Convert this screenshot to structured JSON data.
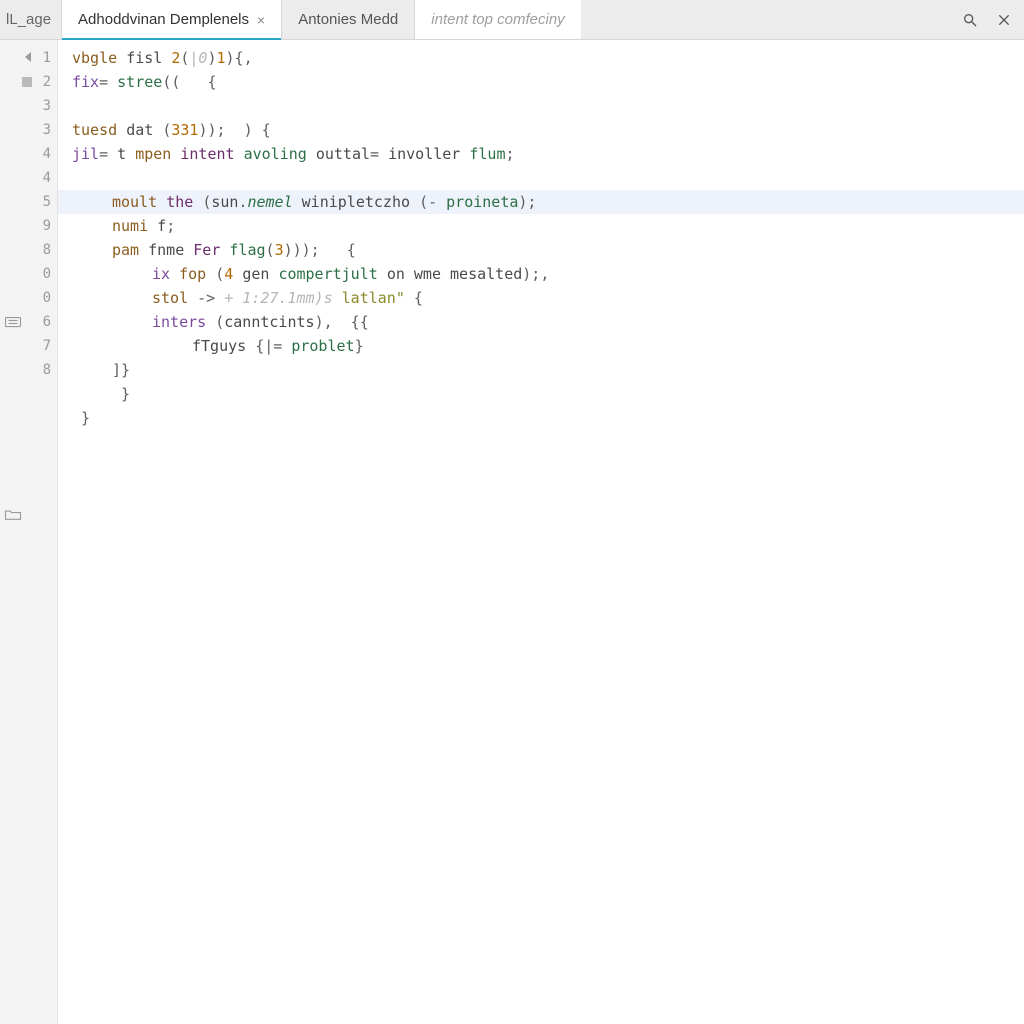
{
  "tabs": {
    "stub_label": "lL_age",
    "items": [
      {
        "label": "Adhoddvinan Demplenels",
        "active": true,
        "closeable": true
      },
      {
        "label": "Antonies Medd",
        "active": false,
        "closeable": false
      }
    ],
    "breadcrumb_hint": "intent top comfeciny"
  },
  "gutter": {
    "lines": [
      {
        "num": "1",
        "fold": true
      },
      {
        "num": "2",
        "bp": true
      },
      {
        "num": "3"
      },
      {
        "num": "3"
      },
      {
        "num": "4"
      },
      {
        "num": "4"
      },
      {
        "num": "5"
      },
      {
        "num": "9"
      },
      {
        "num": "8"
      },
      {
        "num": "0"
      },
      {
        "num": "0"
      },
      {
        "num": "6",
        "marker": "collapse"
      },
      {
        "num": "7"
      },
      {
        "num": "8"
      },
      {
        "num": ""
      },
      {
        "num": ""
      }
    ],
    "folder_marker_line_index": 19
  },
  "code": {
    "lines": [
      {
        "indent": 0,
        "tokens": [
          {
            "t": "vbgle ",
            "c": "tk-kw2"
          },
          {
            "t": "fisl ",
            "c": "tk-id"
          },
          {
            "t": "2",
            "c": "tk-num"
          },
          {
            "t": "(",
            "c": "tk-punc"
          },
          {
            "t": "|0",
            "c": "tk-cmt"
          },
          {
            "t": ")",
            "c": "tk-punc"
          },
          {
            "t": "1",
            "c": "tk-num"
          },
          {
            "t": "){,",
            "c": "tk-punc"
          }
        ]
      },
      {
        "indent": 0,
        "tokens": [
          {
            "t": "fix",
            "c": "tk-kw"
          },
          {
            "t": "= ",
            "c": "tk-op"
          },
          {
            "t": "stree",
            "c": "tk-fn"
          },
          {
            "t": "((   {",
            "c": "tk-punc"
          }
        ]
      },
      {
        "indent": 0,
        "tokens": []
      },
      {
        "indent": 0,
        "tokens": [
          {
            "t": "tuesd ",
            "c": "tk-kw2"
          },
          {
            "t": "dat ",
            "c": "tk-id"
          },
          {
            "t": "(",
            "c": "tk-punc"
          },
          {
            "t": "331",
            "c": "tk-num"
          },
          {
            "t": "));  ) {",
            "c": "tk-punc"
          }
        ]
      },
      {
        "indent": 0,
        "tokens": [
          {
            "t": "jil",
            "c": "tk-kw"
          },
          {
            "t": "= ",
            "c": "tk-op"
          },
          {
            "t": "t ",
            "c": "tk-id"
          },
          {
            "t": "mpen ",
            "c": "tk-kw2"
          },
          {
            "t": "intent ",
            "c": "tk-prop"
          },
          {
            "t": "avoling ",
            "c": "tk-fn"
          },
          {
            "t": "outtal",
            "c": "tk-id"
          },
          {
            "t": "= ",
            "c": "tk-op"
          },
          {
            "t": "involler ",
            "c": "tk-id"
          },
          {
            "t": "flum",
            "c": "tk-fn"
          },
          {
            "t": ";",
            "c": "tk-punc"
          }
        ]
      },
      {
        "indent": 0,
        "tokens": []
      },
      {
        "indent": 1,
        "hl": true,
        "tokens": [
          {
            "t": "moult ",
            "c": "tk-kw2"
          },
          {
            "t": "the ",
            "c": "tk-prop"
          },
          {
            "t": "(",
            "c": "tk-punc"
          },
          {
            "t": "sun",
            "c": "tk-id"
          },
          {
            "t": ".",
            "c": "tk-punc"
          },
          {
            "t": "nemel ",
            "c": "tk-type"
          },
          {
            "t": "winipletczho ",
            "c": "tk-id"
          },
          {
            "t": "(- ",
            "c": "tk-punc"
          },
          {
            "t": "proineta",
            "c": "tk-fn"
          },
          {
            "t": ");",
            "c": "tk-punc"
          }
        ]
      },
      {
        "indent": 1,
        "tokens": [
          {
            "t": "numi ",
            "c": "tk-kw2"
          },
          {
            "t": "f",
            "c": "tk-id"
          },
          {
            "t": ";",
            "c": "tk-punc"
          }
        ]
      },
      {
        "indent": 1,
        "tokens": [
          {
            "t": "pam ",
            "c": "tk-kw2"
          },
          {
            "t": "fnme ",
            "c": "tk-id"
          },
          {
            "t": "Fer ",
            "c": "tk-prop"
          },
          {
            "t": "flag",
            "c": "tk-fn"
          },
          {
            "t": "(",
            "c": "tk-punc"
          },
          {
            "t": "3",
            "c": "tk-num"
          },
          {
            "t": ")));   {",
            "c": "tk-punc"
          }
        ]
      },
      {
        "indent": 2,
        "tokens": [
          {
            "t": "ix ",
            "c": "tk-kw"
          },
          {
            "t": "fop ",
            "c": "tk-kw2"
          },
          {
            "t": "(",
            "c": "tk-punc"
          },
          {
            "t": "4 ",
            "c": "tk-num"
          },
          {
            "t": "gen ",
            "c": "tk-id"
          },
          {
            "t": "compertjult ",
            "c": "tk-fn"
          },
          {
            "t": "on ",
            "c": "tk-id"
          },
          {
            "t": "wme ",
            "c": "tk-id"
          },
          {
            "t": "mesalted",
            "c": "tk-id"
          },
          {
            "t": ");,",
            "c": "tk-punc"
          }
        ]
      },
      {
        "indent": 2,
        "tokens": [
          {
            "t": "stol ",
            "c": "tk-kw2"
          },
          {
            "t": "-> ",
            "c": "tk-op"
          },
          {
            "t": "+ 1:27.1mm)s ",
            "c": "tk-cmt"
          },
          {
            "t": "latlan\" ",
            "c": "tk-str"
          },
          {
            "t": "{",
            "c": "tk-punc"
          }
        ]
      },
      {
        "indent": 2,
        "tokens": [
          {
            "t": "inters ",
            "c": "tk-kw"
          },
          {
            "t": "(",
            "c": "tk-punc"
          },
          {
            "t": "canntcints",
            "c": "tk-id"
          },
          {
            "t": "),  {{",
            "c": "tk-punc"
          }
        ]
      },
      {
        "indent": 3,
        "tokens": [
          {
            "t": "fTguys ",
            "c": "tk-id"
          },
          {
            "t": "{|= ",
            "c": "tk-punc"
          },
          {
            "t": "problet",
            "c": "tk-fn"
          },
          {
            "t": "}",
            "c": "tk-punc"
          }
        ]
      },
      {
        "indent": 1,
        "tokens": [
          {
            "t": "]}",
            "c": "tk-punc"
          }
        ]
      },
      {
        "indent": 1,
        "tokens": [
          {
            "t": " }",
            "c": "tk-punc"
          }
        ]
      },
      {
        "indent": 0,
        "tokens": [
          {
            "t": " }",
            "c": "tk-punc"
          }
        ]
      }
    ]
  }
}
